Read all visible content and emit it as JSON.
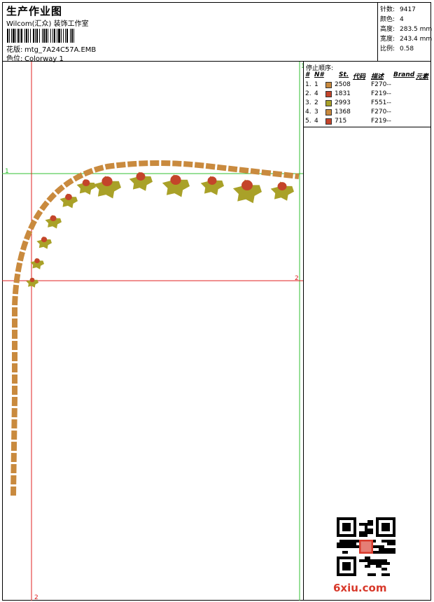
{
  "header": {
    "title": "生产作业图",
    "company": "Wilcom(汇众) 装饰工作室",
    "design_label": "花版:",
    "design_value": "mtg_7A24C57A.EMB",
    "color_label": "色位:",
    "color_value": "Colorway 1"
  },
  "stats": [
    {
      "label": "针数:",
      "value": "9417"
    },
    {
      "label": "颜色:",
      "value": "4"
    },
    {
      "label": "高度:",
      "value": "283.5 mm"
    },
    {
      "label": "宽度:",
      "value": "243.4 mm"
    },
    {
      "label": "比例:",
      "value": "0.58"
    }
  ],
  "stop_sequence": {
    "title": "停止顺序:",
    "headers": [
      "#",
      "N#",
      "St.",
      "代码",
      "描述",
      "Brand",
      "元素"
    ],
    "rows": [
      {
        "n": "1.",
        "needle": "1",
        "color": "#c98a3e",
        "stitches": "2508",
        "desc": "F270--"
      },
      {
        "n": "2.",
        "needle": "4",
        "color": "#c4442a",
        "stitches": "1831",
        "desc": "F219--"
      },
      {
        "n": "3.",
        "needle": "2",
        "color": "#a9a128",
        "stitches": "2993",
        "desc": "F551--"
      },
      {
        "n": "4.",
        "needle": "3",
        "color": "#c98a3e",
        "stitches": "1368",
        "desc": "F270--"
      },
      {
        "n": "5.",
        "needle": "4",
        "color": "#c4442a",
        "stitches": " 715",
        "desc": "F219--"
      }
    ]
  },
  "guides": {
    "h1": "1",
    "h2": "2",
    "v1": "1",
    "v2": "2"
  },
  "colors": {
    "border": "#c98a3e",
    "leaf": "#a9a128",
    "berry": "#c4442a",
    "guide_red": "#e02020",
    "guide_green": "#30c030"
  },
  "watermark": "6xiu.com"
}
